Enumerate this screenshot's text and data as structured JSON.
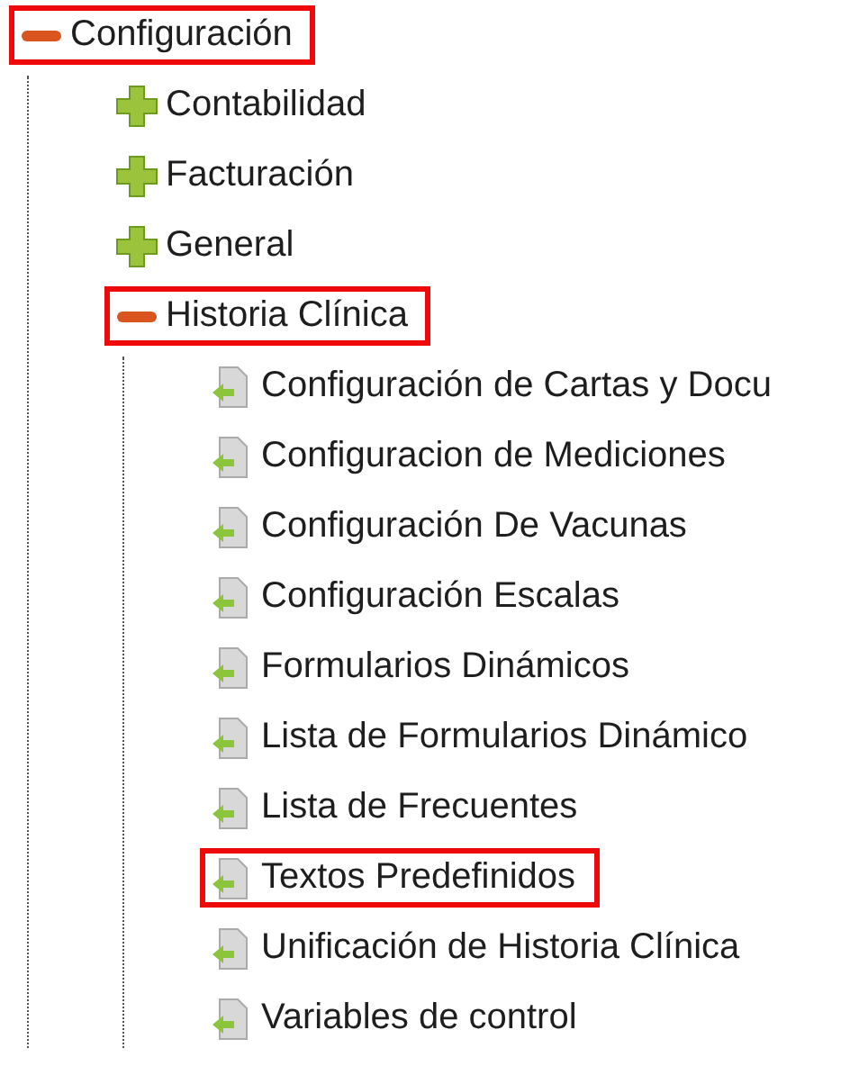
{
  "tree": [
    {
      "label": "Configuración",
      "kind": "folder",
      "expanded": true,
      "highlighted": true,
      "children": [
        {
          "label": "Contabilidad",
          "kind": "folder",
          "expanded": false,
          "highlighted": false
        },
        {
          "label": "Facturación",
          "kind": "folder",
          "expanded": false,
          "highlighted": false
        },
        {
          "label": "General",
          "kind": "folder",
          "expanded": false,
          "highlighted": false
        },
        {
          "label": "Historia Clínica",
          "kind": "folder",
          "expanded": true,
          "highlighted": true,
          "children": [
            {
              "label": "Configuración de Cartas y Docu",
              "kind": "page",
              "highlighted": false
            },
            {
              "label": "Configuracion de Mediciones",
              "kind": "page",
              "highlighted": false
            },
            {
              "label": "Configuración De Vacunas",
              "kind": "page",
              "highlighted": false
            },
            {
              "label": "Configuración Escalas",
              "kind": "page",
              "highlighted": false
            },
            {
              "label": "Formularios Dinámicos",
              "kind": "page",
              "highlighted": false
            },
            {
              "label": "Lista de Formularios Dinámico",
              "kind": "page",
              "highlighted": false
            },
            {
              "label": "Lista de Frecuentes",
              "kind": "page",
              "highlighted": false
            },
            {
              "label": "Textos Predefinidos",
              "kind": "page",
              "highlighted": true
            },
            {
              "label": "Unificación de Historia Clínica",
              "kind": "page",
              "highlighted": false
            },
            {
              "label": "Variables de control",
              "kind": "page",
              "highlighted": false
            }
          ]
        }
      ]
    }
  ]
}
